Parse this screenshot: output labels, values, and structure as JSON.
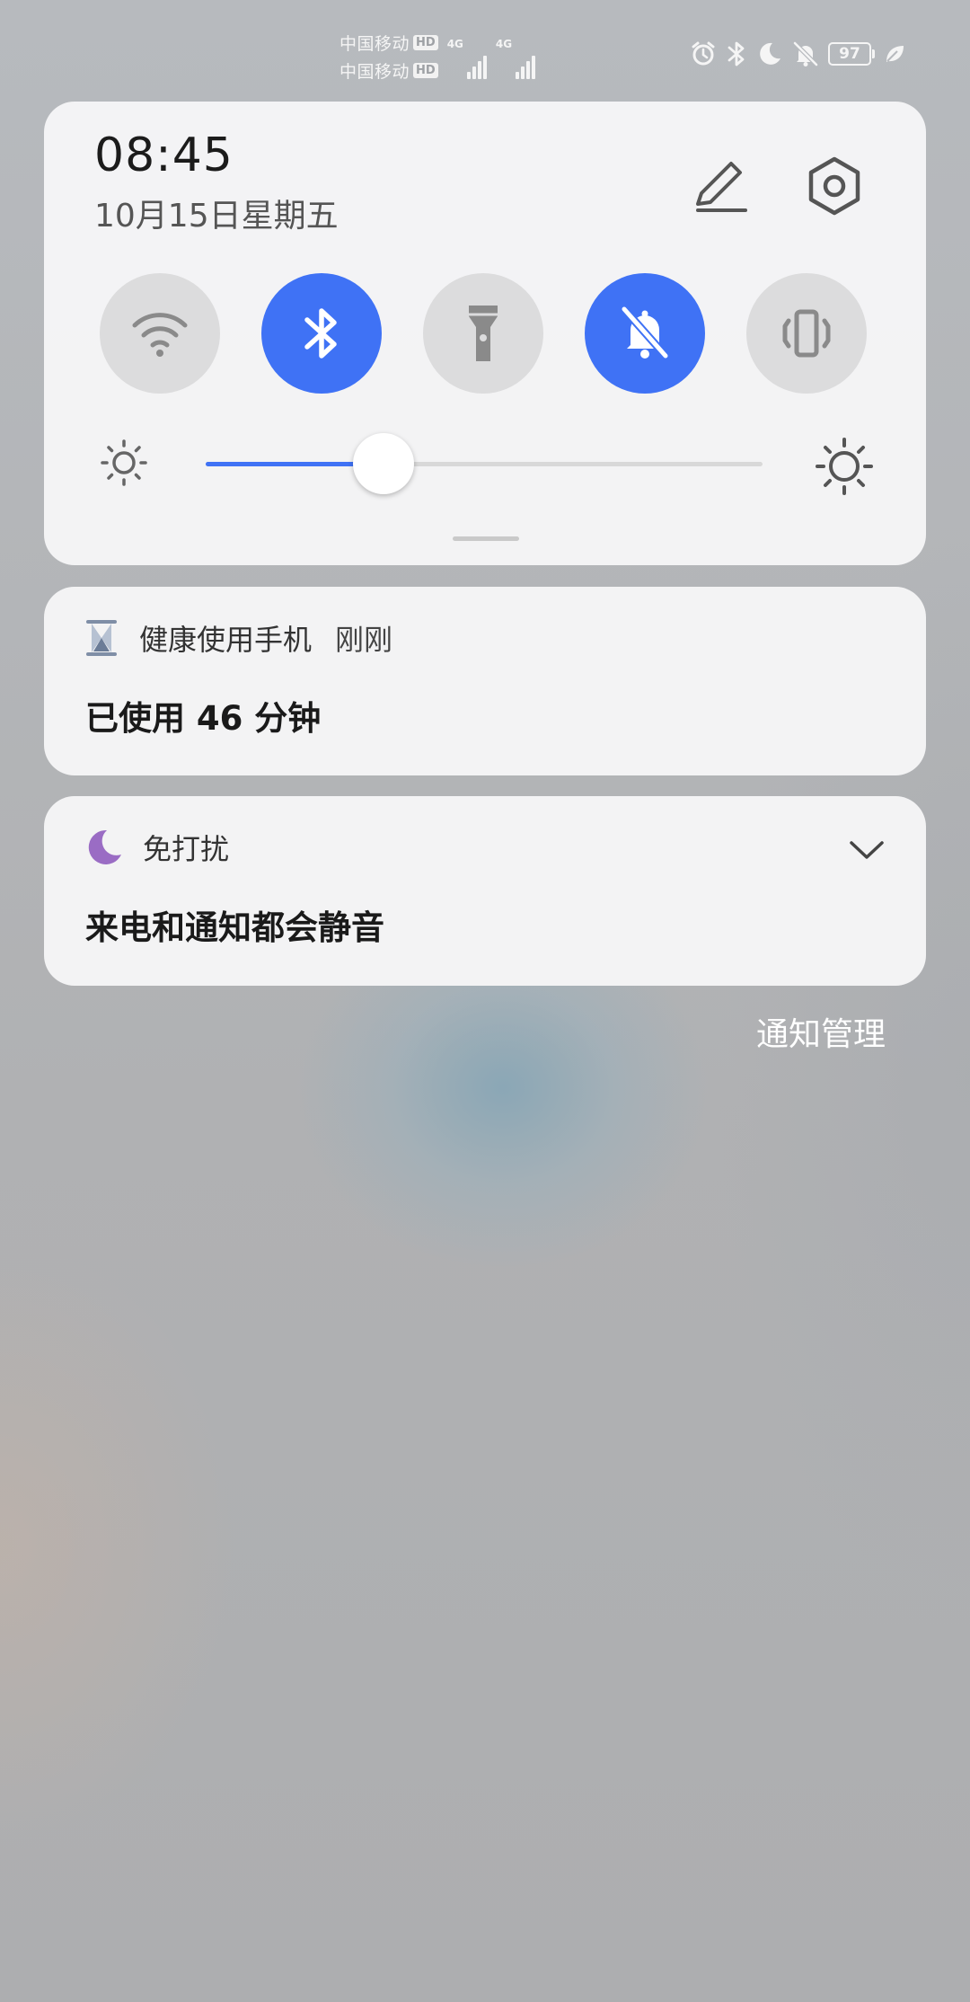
{
  "status_bar": {
    "carrier_1": "中国移动",
    "carrier_2": "中国移动",
    "hd_badge": "HD",
    "network_label_1": "4G",
    "network_label_2": "4G",
    "battery_level": "97",
    "icons": [
      "alarm-icon",
      "bluetooth-icon",
      "moon-icon",
      "bell-off-icon",
      "battery-icon",
      "leaf-icon"
    ]
  },
  "quick_settings": {
    "time": "08:45",
    "date": "10月15日星期五",
    "toggles": [
      {
        "icon": "wifi-icon",
        "state": "off"
      },
      {
        "icon": "bluetooth-icon",
        "state": "on"
      },
      {
        "icon": "flashlight-icon",
        "state": "off"
      },
      {
        "icon": "bell-off-icon",
        "state": "on"
      },
      {
        "icon": "vibrate-icon",
        "state": "off"
      }
    ],
    "brightness_level": 0.32,
    "colors": {
      "accent": "#3f72f5",
      "toggle_off": "#dcdcdd"
    }
  },
  "notifications": [
    {
      "app": "健康使用手机",
      "time": "刚刚",
      "body": "已使用 46 分钟",
      "icon": "hourglass-icon"
    },
    {
      "app": "免打扰",
      "body": "来电和通知都会静音",
      "icon": "moon-icon"
    }
  ],
  "footer": {
    "manage_label": "通知管理"
  }
}
